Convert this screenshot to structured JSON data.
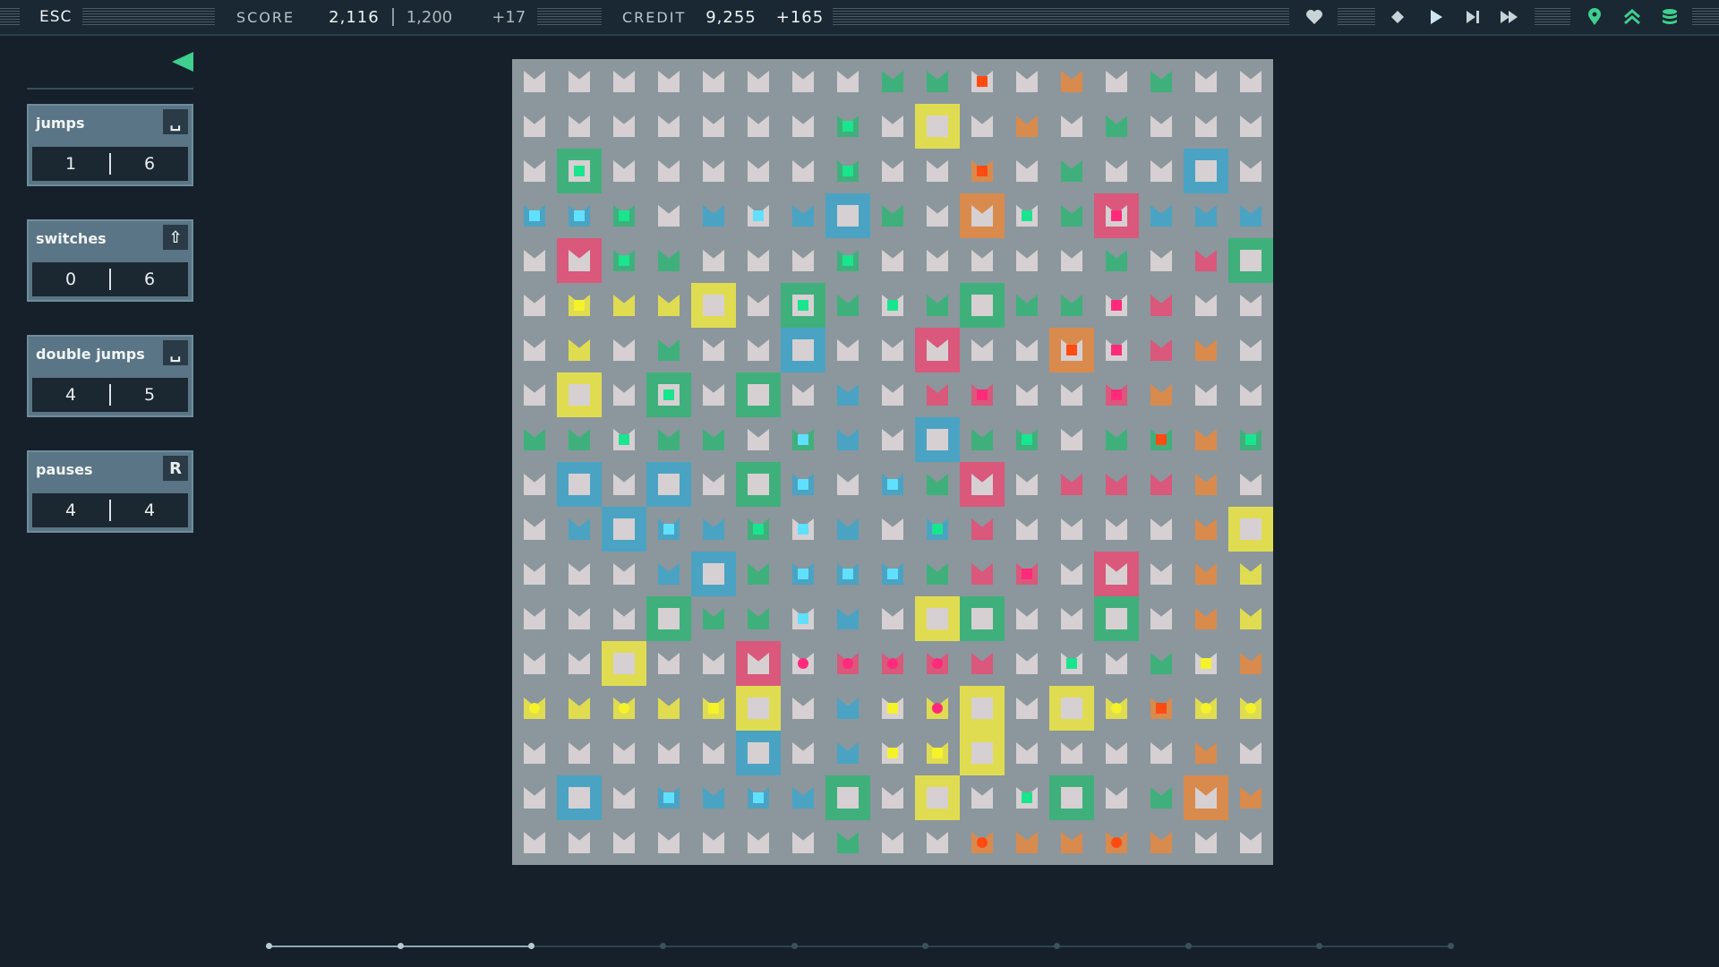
{
  "topbar": {
    "esc_label": "ESC",
    "score_label": "SCORE",
    "score_value": "2,116",
    "score_target": "1,200",
    "score_delta": "+17",
    "credit_label": "CREDIT",
    "credit_value": "9,255",
    "credit_delta": "+165",
    "icons": [
      "heart-icon",
      "diamond-icon",
      "play-icon",
      "step-forward-icon",
      "fast-forward-icon",
      "map-pin-icon",
      "double-chevron-up-icon",
      "database-icon"
    ]
  },
  "side": {
    "cards": [
      {
        "title": "jumps",
        "key": "␣",
        "used": "1",
        "total": "6"
      },
      {
        "title": "switches",
        "key": "⇧",
        "used": "0",
        "total": "6"
      },
      {
        "title": "double jumps",
        "key": "␣",
        "used": "4",
        "total": "5"
      },
      {
        "title": "pauses",
        "key": "R",
        "used": "4",
        "total": "4"
      }
    ]
  },
  "colors": {
    "g": "#3fb07c",
    "b": "#4aa3c3",
    "p": "#d9587c",
    "y": "#e0dc52",
    "o": "#d98a4d",
    "piece_g": "#19e58f",
    "piece_b": "#5fe0ff",
    "piece_p": "#ff2a7a",
    "piece_y": "#f5f22a",
    "piece_o": "#ff4a12"
  },
  "board": {
    "rows": [
      "........gg..o.g....",
      ".......g.Y.o.g.....",
      ".G.....g..o.g..B...",
      "bbg+b.bBg.O.gPbbb..",
      ".Pgg...g.....g.pG..",
      ".yyyY.Gg.gGgg.p....",
      ".y.g..B..P..O.po...",
      ".Y.G.G.b.pp..po....",
      "gg.gg.gb.Bgg.ggogg.",
      ".B.B.Gb.bgP.pppo...",
      ".bBbbg.b.bp....oY..",
      "...bBgbbbgpp.P.oy..",
      "...Ggg.b.YG..G.oy..",
      "..Y..P.pppp...g.oy.",
      "yyyyyY.b.yY.Yyoyyy.",
      ".....B.b.yY....o...",
      ".B.bbbbG.Y..G.gOo..",
      ".......g..ooooo...."
    ],
    "pieces": [
      {
        "r": 0,
        "c": 10,
        "k": "o"
      },
      {
        "r": 1,
        "c": 7,
        "k": "g"
      },
      {
        "r": 2,
        "c": 1,
        "k": "g"
      },
      {
        "r": 2,
        "c": 7,
        "k": "g"
      },
      {
        "r": 2,
        "c": 10,
        "k": "o"
      },
      {
        "r": 3,
        "c": 0,
        "k": "b"
      },
      {
        "r": 3,
        "c": 1,
        "k": "b"
      },
      {
        "r": 3,
        "c": 2,
        "k": "g"
      },
      {
        "r": 3,
        "c": 5,
        "k": "b"
      },
      {
        "r": 3,
        "c": 11,
        "k": "g"
      },
      {
        "r": 3,
        "c": 13,
        "k": "p"
      },
      {
        "r": 4,
        "c": 7,
        "k": "g"
      },
      {
        "r": 4,
        "c": 2,
        "k": "g"
      },
      {
        "r": 5,
        "c": 1,
        "k": "y"
      },
      {
        "r": 5,
        "c": 6,
        "k": "g"
      },
      {
        "r": 5,
        "c": 8,
        "k": "g"
      },
      {
        "r": 5,
        "c": 13,
        "k": "p"
      },
      {
        "r": 6,
        "c": 12,
        "k": "o"
      },
      {
        "r": 6,
        "c": 13,
        "k": "p"
      },
      {
        "r": 7,
        "c": 3,
        "k": "g"
      },
      {
        "r": 7,
        "c": 10,
        "k": "p"
      },
      {
        "r": 7,
        "c": 13,
        "k": "p"
      },
      {
        "r": 8,
        "c": 2,
        "k": "g"
      },
      {
        "r": 8,
        "c": 6,
        "k": "b"
      },
      {
        "r": 8,
        "c": 11,
        "k": "g"
      },
      {
        "r": 8,
        "c": 14,
        "k": "o"
      },
      {
        "r": 8,
        "c": 16,
        "k": "g"
      },
      {
        "r": 9,
        "c": 6,
        "k": "b"
      },
      {
        "r": 9,
        "c": 8,
        "k": "b"
      },
      {
        "r": 10,
        "c": 3,
        "k": "b"
      },
      {
        "r": 10,
        "c": 5,
        "k": "g"
      },
      {
        "r": 10,
        "c": 6,
        "k": "b"
      },
      {
        "r": 10,
        "c": 9,
        "k": "g"
      },
      {
        "r": 11,
        "c": 6,
        "k": "b"
      },
      {
        "r": 11,
        "c": 7,
        "k": "b"
      },
      {
        "r": 11,
        "c": 8,
        "k": "b"
      },
      {
        "r": 11,
        "c": 11,
        "k": "p"
      },
      {
        "r": 12,
        "c": 6,
        "k": "b"
      },
      {
        "r": 13,
        "c": 6,
        "k": "p",
        "round": true
      },
      {
        "r": 13,
        "c": 7,
        "k": "p",
        "round": true
      },
      {
        "r": 13,
        "c": 8,
        "k": "p",
        "round": true
      },
      {
        "r": 13,
        "c": 9,
        "k": "p",
        "round": true
      },
      {
        "r": 13,
        "c": 12,
        "k": "g"
      },
      {
        "r": 13,
        "c": 15,
        "k": "y"
      },
      {
        "r": 14,
        "c": 0,
        "k": "y",
        "round": true
      },
      {
        "r": 14,
        "c": 2,
        "k": "y",
        "round": true
      },
      {
        "r": 14,
        "c": 4,
        "k": "y"
      },
      {
        "r": 14,
        "c": 8,
        "k": "y"
      },
      {
        "r": 14,
        "c": 9,
        "k": "p",
        "round": true
      },
      {
        "r": 14,
        "c": 13,
        "k": "y",
        "round": true
      },
      {
        "r": 14,
        "c": 15,
        "k": "y",
        "round": true
      },
      {
        "r": 14,
        "c": 16,
        "k": "y",
        "round": true
      },
      {
        "r": 14,
        "c": 14,
        "k": "o"
      },
      {
        "r": 15,
        "c": 8,
        "k": "y"
      },
      {
        "r": 15,
        "c": 9,
        "k": "y"
      },
      {
        "r": 16,
        "c": 3,
        "k": "b"
      },
      {
        "r": 16,
        "c": 5,
        "k": "b"
      },
      {
        "r": 16,
        "c": 11,
        "k": "g"
      },
      {
        "r": 17,
        "c": 10,
        "k": "o",
        "round": true
      },
      {
        "r": 17,
        "c": 13,
        "k": "o",
        "round": true
      }
    ]
  },
  "timeline": {
    "steps": 10,
    "done": 3
  }
}
